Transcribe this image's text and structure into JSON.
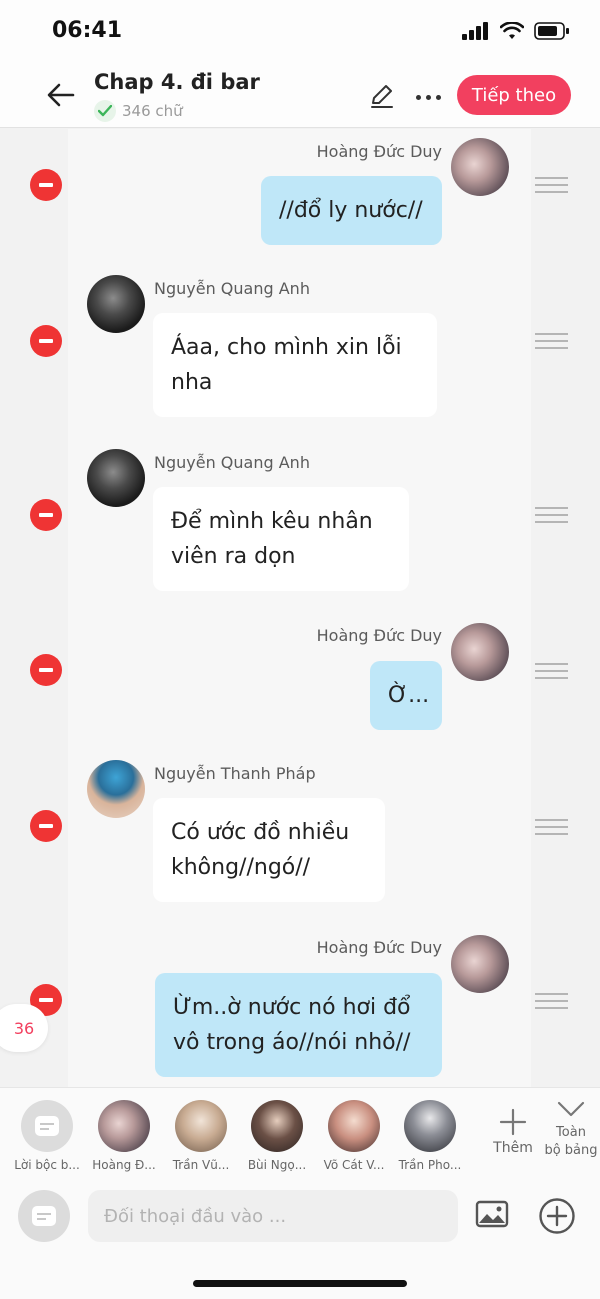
{
  "status_bar": {
    "time": "06:41"
  },
  "header": {
    "title": "Chap 4. đi bar",
    "word_count": "346 chữ",
    "next_label": "Tiếp theo"
  },
  "messages": [
    {
      "side": "right",
      "name": "Hoàng Đức Duy",
      "text": "//đổ ly nước//"
    },
    {
      "side": "left",
      "name": "Nguyễn Quang Anh",
      "text": "Áaa, cho mình xin lỗi nha"
    },
    {
      "side": "left",
      "name": "Nguyễn Quang Anh",
      "text": "Để mình kêu nhân viên ra dọn"
    },
    {
      "side": "right",
      "name": "Hoàng Đức Duy",
      "text": "Ờ..."
    },
    {
      "side": "left",
      "name": "Nguyễn Thanh Pháp",
      "text": "Có ước đồ nhiều không//ngó//"
    },
    {
      "side": "right",
      "name": "Hoàng Đức Duy",
      "text": "Ừm..ờ nước nó hơi đổ vô trong áo//nói nhỏ//"
    }
  ],
  "unread_count": "36",
  "characters": [
    {
      "label": "Lời bộc b..."
    },
    {
      "label": "Hoàng Đ..."
    },
    {
      "label": "Trần Vũ..."
    },
    {
      "label": "Bùi Ngọ..."
    },
    {
      "label": "Võ Cát V..."
    },
    {
      "label": "Trần Pho..."
    }
  ],
  "add_label": "Thêm",
  "all_label_line1": "Toàn",
  "all_label_line2": "bộ bảng",
  "input": {
    "placeholder": "Đối thoại đầu vào ..."
  },
  "colors": {
    "accent": "#f2405f",
    "right_bubble": "#bfe7f8",
    "delete": "#ef3434"
  }
}
